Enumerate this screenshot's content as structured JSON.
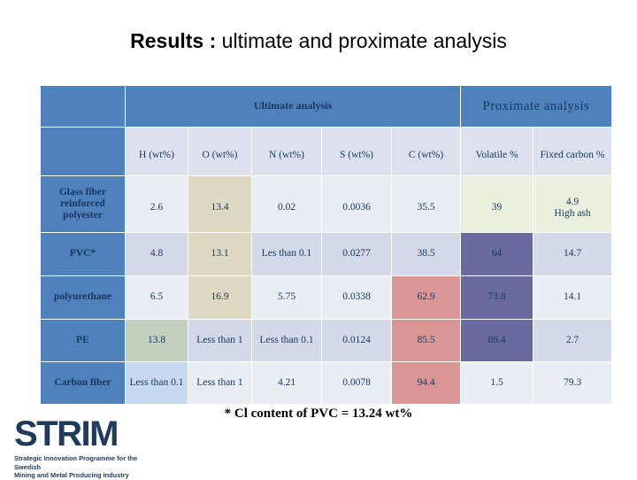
{
  "title": {
    "strong": "Results :",
    "rest": " ultimate and proximate analysis"
  },
  "table": {
    "groups": {
      "ultimate": "Ultimate analysis",
      "proximate": "Proximate analysis"
    },
    "columns": [
      "H (wt%)",
      "O (wt%)",
      "N (wt%)",
      "S (wt%)",
      "C (wt%)",
      "Volatile %",
      "Fixed carbon %"
    ],
    "rows": [
      {
        "label": "Glass fiber reinforced polyester",
        "cells": [
          "2.6",
          "13.4",
          "0.02",
          "0.0036",
          "35.5",
          "39",
          "4.9\nHigh ash"
        ]
      },
      {
        "label": "PVC*",
        "cells": [
          "4.8",
          "13.1",
          "Les than 0.1",
          "0.0277",
          "38.5",
          "64",
          "14.7"
        ]
      },
      {
        "label": "polyurethane",
        "cells": [
          "6.5",
          "16.9",
          "5.75",
          "0.0338",
          "62.9",
          "73.8",
          "14.1"
        ]
      },
      {
        "label": "PE",
        "cells": [
          "13.8",
          "Less than 1",
          "Less than 0.1",
          "0.0124",
          "85.5",
          "89.4",
          "2.7"
        ]
      },
      {
        "label": "Carbon fiber",
        "cells": [
          "Less than 0.1",
          "Less than 1",
          "4.21",
          "0.0078",
          "94.4",
          "1.5",
          "79.3"
        ]
      }
    ],
    "cell_colors": [
      [
        "#e9edf4",
        "#ddd9c3",
        "#e9edf4",
        "#e9edf4",
        "#e9edf4",
        "#ebf0de",
        "#ebf0de"
      ],
      [
        "#d3d9e8",
        "#ddd9c3",
        "#d3d9e8",
        "#d3d9e8",
        "#d3d9e8",
        "#6a6aa0",
        "#d3d9e8"
      ],
      [
        "#e9edf4",
        "#ddd9c3",
        "#e9edf4",
        "#e9edf4",
        "#d99694",
        "#6a6aa0",
        "#e9edf4"
      ],
      [
        "#c3d0bf",
        "#d3d9e8",
        "#d3d9e8",
        "#d3d9e8",
        "#d99694",
        "#6a6aa0",
        "#d3d9e8"
      ],
      [
        "#c6d9f0",
        "#e9edf4",
        "#e9edf4",
        "#e9edf4",
        "#d99694",
        "#e9edf4",
        "#e9edf4"
      ]
    ],
    "header_color": "#4f81bd",
    "column_header_color": "#dce1ed"
  },
  "footnote": "* Cl content of PVC = 13.24 wt%",
  "logo": {
    "mark": "STRIM",
    "tagline_line1": "Strategic Innovation Programme for the Swedish",
    "tagline_line2": "Mining and Metal Producing Industry"
  }
}
